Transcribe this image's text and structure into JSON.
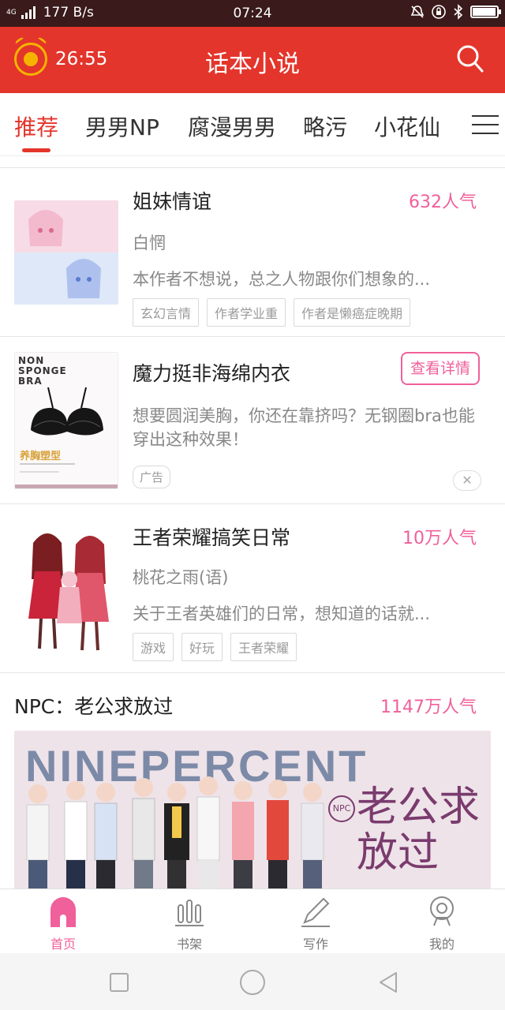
{
  "status_bar": {
    "network": "4G",
    "speed": "177 B/s",
    "time": "07:24"
  },
  "header": {
    "timer": "26:55",
    "title": "话本小说",
    "icons": {
      "timer": "alarm-coin-icon",
      "search": "search-icon"
    }
  },
  "tabs": {
    "items": [
      "推荐",
      "男男NP",
      "腐漫男男",
      "略污",
      "小花仙"
    ],
    "active": "推荐",
    "menu_icon": "menu-icon"
  },
  "feed": {
    "items": [
      {
        "title": "姐妹情谊",
        "popularity": "632人气",
        "author": "白惘",
        "description": "本作者不想说，总之人物跟你们想象的...",
        "tags": [
          "玄幻言情",
          "作者学业重",
          "作者是懒癌症晚期"
        ]
      },
      {
        "title": "王者荣耀搞笑日常",
        "popularity": "10万人气",
        "author": "桃花之雨(语)",
        "description": "关于王者英雄们的日常，想知道的话就...",
        "tags": [
          "游戏",
          "好玩",
          "王者荣耀"
        ]
      }
    ],
    "ad": {
      "title": "魔力挺非海绵内衣",
      "button": "查看详情",
      "description": "想要圆润美胸，你还在靠挤吗？无钢圈bra也能穿出这种效果！",
      "badge": "广告",
      "close": "✕",
      "image_text": [
        "NON",
        "SPONGE",
        "BRA",
        "养胸塑型"
      ]
    },
    "featured": {
      "title": "NPC：老公求放过",
      "popularity": "1147万人气",
      "banner_text": "NINEPERCENT",
      "banner_title": "老公求放过",
      "banner_badge": "NPC"
    }
  },
  "bottom_nav": {
    "items": [
      "首页",
      "书架",
      "写作",
      "我的"
    ],
    "active": "首页"
  },
  "colors": {
    "header": "#e3352b",
    "accent_pink": "#f0609a",
    "status_bar": "#3a1a1a"
  }
}
